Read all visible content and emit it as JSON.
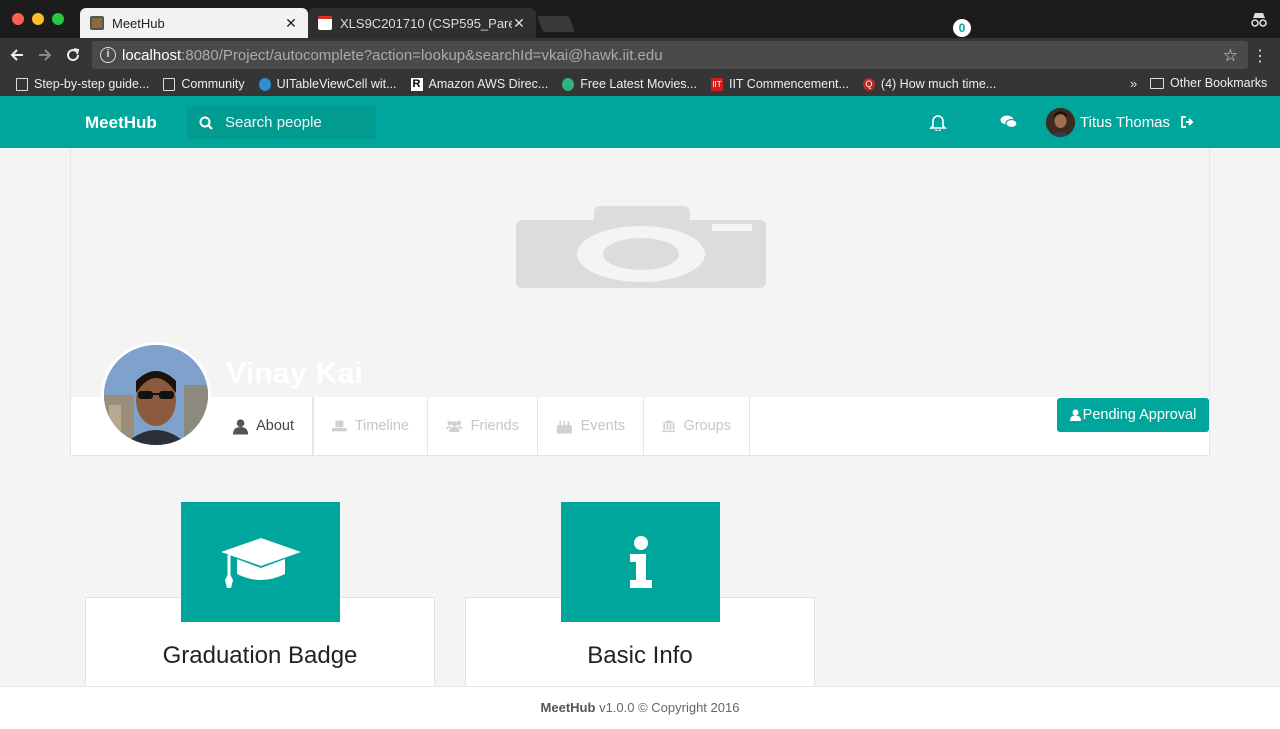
{
  "browser": {
    "tabs": [
      {
        "title": "MeetHub",
        "active": true
      },
      {
        "title": "XLS9C201710 (CSP595_Pare",
        "active": false
      }
    ],
    "url_host": "localhost",
    "url_rest": ":8080/Project/autocomplete?action=lookup&searchId=vkai@hawk.iit.edu",
    "bookmarks": [
      {
        "label": "Step-by-step guide...",
        "icon": "doc-icon"
      },
      {
        "label": "Community",
        "icon": "doc-icon"
      },
      {
        "label": "UITableViewCell wit...",
        "icon": "wordpress-icon"
      },
      {
        "label": "Amazon AWS Direc...",
        "icon": "r-icon"
      },
      {
        "label": "Free Latest Movies...",
        "icon": "play-icon"
      },
      {
        "label": "IIT Commencement...",
        "icon": "iit-icon"
      },
      {
        "label": "(4) How much time...",
        "icon": "quora-icon"
      }
    ],
    "bookmarks_more": "»",
    "other_bookmarks": "Other Bookmarks"
  },
  "app": {
    "brand": "MeetHub",
    "search_placeholder": "Search people",
    "notification_count": "0",
    "user_name": "Titus Thomas",
    "accent": "#00a69c"
  },
  "profile": {
    "name": "Vinay Kai",
    "pending_label": "Pending Approval",
    "tabs": [
      {
        "label": "About",
        "icon": "user-icon",
        "active": true
      },
      {
        "label": "Timeline",
        "icon": "timeline-icon",
        "active": false
      },
      {
        "label": "Friends",
        "icon": "friends-icon",
        "active": false
      },
      {
        "label": "Events",
        "icon": "cake-icon",
        "active": false
      },
      {
        "label": "Groups",
        "icon": "bank-icon",
        "active": false
      }
    ]
  },
  "cards": [
    {
      "title": "Graduation Badge",
      "icon": "graduation-cap-icon"
    },
    {
      "title": "Basic Info",
      "icon": "info-icon"
    }
  ],
  "footer": {
    "brand": "MeetHub",
    "text": "v1.0.0 © Copyright 2016"
  }
}
